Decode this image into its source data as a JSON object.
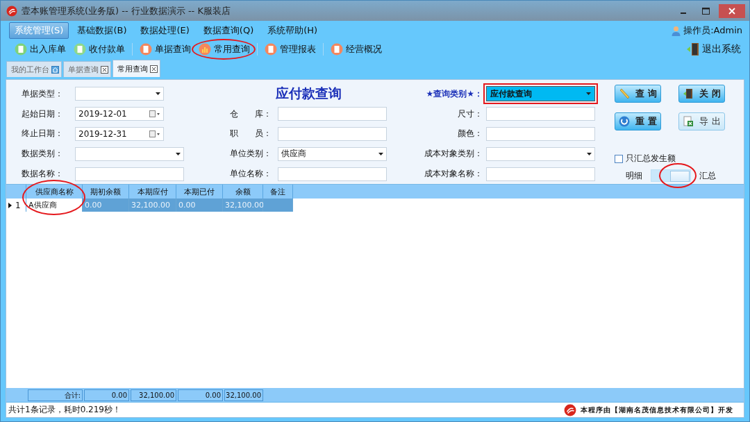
{
  "window": {
    "title": "壹本账管理系统(业务版) -- 行业数据演示 -- K服装店"
  },
  "menu": [
    {
      "label": "系统管理(S)",
      "selected": true
    },
    {
      "label": "基础数据(B)",
      "selected": false
    },
    {
      "label": "数据处理(E)",
      "selected": false
    },
    {
      "label": "数据查询(Q)",
      "selected": false
    },
    {
      "label": "系统帮助(H)",
      "selected": false
    }
  ],
  "operator": "操作员:Admin",
  "toolbar": [
    {
      "label": "出入库单",
      "kind": "stock",
      "highlighted": false
    },
    {
      "label": "收付款单",
      "kind": "payment",
      "highlighted": false
    },
    {
      "label": "单据查询",
      "kind": "document",
      "highlighted": false
    },
    {
      "label": "常用查询",
      "kind": "chart",
      "highlighted": true
    },
    {
      "label": "管理报表",
      "kind": "report",
      "highlighted": false
    },
    {
      "label": "经营概况",
      "kind": "overview",
      "highlighted": false
    }
  ],
  "exit": "退出系统",
  "tabs": [
    {
      "label": "我的工作台",
      "kind": "home",
      "selected": false
    },
    {
      "label": "单据查询",
      "kind": "closable",
      "selected": false
    },
    {
      "label": "常用查询",
      "kind": "closable",
      "selected": true
    }
  ],
  "form": {
    "title": "应付款查询",
    "left_fields": [
      {
        "label": "单据类型：",
        "kind": "select"
      },
      {
        "label": "起始日期：",
        "kind": "date",
        "value": "2019-12-01"
      },
      {
        "label": "终止日期：",
        "kind": "date",
        "value": "2019-12-31"
      },
      {
        "label": "数据类别：",
        "kind": "select"
      },
      {
        "label": "数据名称：",
        "kind": "text"
      }
    ],
    "middle_fields": [
      {
        "label": "仓　　库：",
        "kind": "text"
      },
      {
        "label": "职　　员：",
        "kind": "text"
      },
      {
        "label": "单位类别：",
        "kind": "select",
        "value": "供应商"
      },
      {
        "label": "单位名称：",
        "kind": "text"
      }
    ],
    "query_type": {
      "label": "★查询类别★：",
      "value": "应付款查询",
      "highlighted": true
    },
    "right_fields": [
      {
        "label": "尺寸：",
        "kind": "text"
      },
      {
        "label": "颜色：",
        "kind": "text"
      },
      {
        "label": "成本对象类别：",
        "kind": "select"
      },
      {
        "label": "成本对象名称：",
        "kind": "text"
      }
    ],
    "buttons": [
      {
        "label": "查 询",
        "kind": "search",
        "disabled": false
      },
      {
        "label": "关 闭",
        "kind": "close",
        "disabled": false
      },
      {
        "label": "重 置",
        "kind": "reset",
        "disabled": false
      },
      {
        "label": "导 出",
        "kind": "export",
        "disabled": true
      }
    ],
    "summary_only": {
      "label": "只汇总发生额",
      "checked": false
    },
    "view_toggle": {
      "left_label": "明细",
      "right_label": "汇总",
      "on": true,
      "highlighted": true
    }
  },
  "table": {
    "columns": [
      {
        "label": "供应商名称",
        "highlighted": true
      },
      {
        "label": "期初余额",
        "highlighted": false
      },
      {
        "label": "本期应付",
        "highlighted": false
      },
      {
        "label": "本期已付",
        "highlighted": false
      },
      {
        "label": "余额",
        "highlighted": false
      },
      {
        "label": "备注",
        "highlighted": false
      }
    ],
    "rows": [
      {
        "number": "1",
        "selected": true,
        "cells": [
          "A供应商",
          "0.00",
          "32,100.00",
          "0.00",
          "32,100.00"
        ]
      }
    ],
    "totals": {
      "label": "合计:",
      "values": [
        "0.00",
        "32,100.00",
        "0.00",
        "32,100.00"
      ]
    }
  },
  "status_bar": {
    "message": "共计1条记录，耗时0.219秒！",
    "credit": "本程序由【湖南名茂信息技术有限公司】开发"
  }
}
